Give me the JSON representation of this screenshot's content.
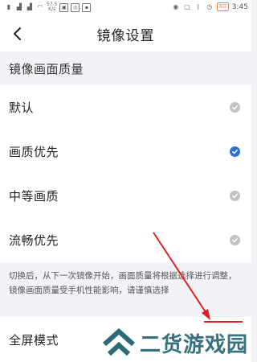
{
  "status_bar": {
    "speed": "57.5\nK/s",
    "battery": "80",
    "time": "3:45"
  },
  "header": {
    "title": "镜像设置"
  },
  "section": {
    "title": "镜像画面质量"
  },
  "options": [
    {
      "label": "默认",
      "selected": false
    },
    {
      "label": "画质优先",
      "selected": true
    },
    {
      "label": "中等画质",
      "selected": false
    },
    {
      "label": "流畅优先",
      "selected": false
    }
  ],
  "hint": {
    "text": "切换后，从下一次镜像开始，画面质量将根据选择进行调整，镜像画面质量受手机性能影响，请谨慎选择"
  },
  "fullscreen": {
    "label": "全屏模式"
  },
  "watermark": {
    "text": "二货游戏园"
  },
  "colors": {
    "accent": "#2f6fd6",
    "unchecked": "#bfc2c7",
    "background": "#f2f3f7",
    "annotation": "#e02020"
  }
}
